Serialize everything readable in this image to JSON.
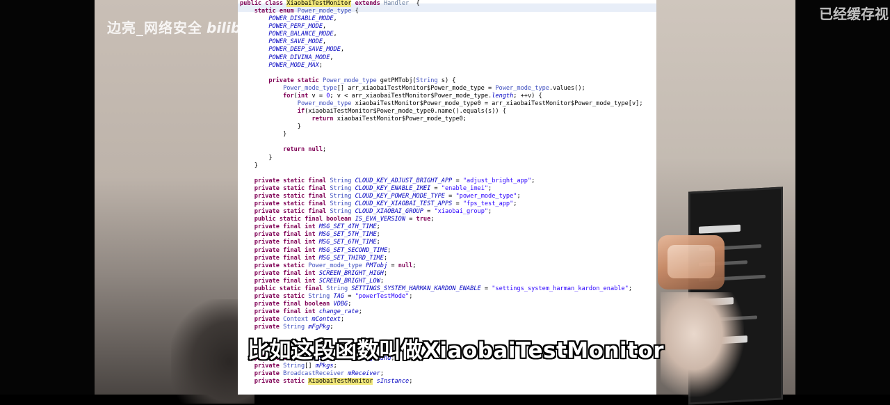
{
  "watermark": {
    "name": "边亮_网络安全",
    "platform": "bilibili"
  },
  "cache_note": "已经缓存视",
  "subtitle": "比如这段函数叫做XiaobaiTestMonitor",
  "code_lines": [
    [
      [
        "kw",
        "public class "
      ],
      [
        "hl",
        "XiaobaiTestMonitor"
      ],
      [
        "kw",
        " extends "
      ],
      [
        "grey",
        "Handler"
      ],
      [
        "",
        "  {"
      ]
    ],
    [
      [
        "",
        "    "
      ],
      [
        "kw",
        "static enum "
      ],
      [
        "ty",
        "Power_mode_type"
      ],
      [
        "",
        " {"
      ]
    ],
    [
      [
        "",
        "        "
      ],
      [
        "fi",
        "POWER_DISABLE_MODE"
      ],
      [
        "",
        ","
      ]
    ],
    [
      [
        "",
        "        "
      ],
      [
        "fi",
        "POWER_PERF_MODE"
      ],
      [
        "",
        ","
      ]
    ],
    [
      [
        "",
        "        "
      ],
      [
        "fi",
        "POWER_BALANCE_MODE"
      ],
      [
        "",
        ","
      ]
    ],
    [
      [
        "",
        "        "
      ],
      [
        "fi",
        "POWER_SAVE_MODE"
      ],
      [
        "",
        ","
      ]
    ],
    [
      [
        "",
        "        "
      ],
      [
        "fi",
        "POWER_DEEP_SAVE_MODE"
      ],
      [
        "",
        ","
      ]
    ],
    [
      [
        "",
        "        "
      ],
      [
        "fi",
        "POWER_DIVINA_MODE"
      ],
      [
        "",
        ","
      ]
    ],
    [
      [
        "",
        "        "
      ],
      [
        "fi",
        "POWER_MODE_MAX"
      ],
      [
        "",
        ";"
      ]
    ],
    [
      [
        "",
        ""
      ]
    ],
    [
      [
        "",
        "        "
      ],
      [
        "kw",
        "private static "
      ],
      [
        "ty",
        "Power_mode_type"
      ],
      [
        "",
        " getPMTobj("
      ],
      [
        "ty",
        "String"
      ],
      [
        "",
        " s) {"
      ]
    ],
    [
      [
        "",
        "            "
      ],
      [
        "ty",
        "Power_mode_type"
      ],
      [
        "",
        "[] arr_xiaobaiTestMonitor$Power_mode_type = "
      ],
      [
        "ty",
        "Power_mode_type"
      ],
      [
        "",
        ".values();"
      ]
    ],
    [
      [
        "",
        "            "
      ],
      [
        "kw",
        "for"
      ],
      [
        "",
        "("
      ],
      [
        "kw",
        "int"
      ],
      [
        "",
        " v = "
      ],
      [
        "st",
        "0"
      ],
      [
        "",
        "; v < arr_xiaobaiTestMonitor$Power_mode_type."
      ],
      [
        "fi",
        "length"
      ],
      [
        "",
        "; ++v) {"
      ]
    ],
    [
      [
        "",
        "                "
      ],
      [
        "ty",
        "Power_mode_type"
      ],
      [
        "",
        " xiaobaiTestMonitor$Power_mode_type0 = arr_xiaobaiTestMonitor$Power_mode_type[v];"
      ]
    ],
    [
      [
        "",
        "                "
      ],
      [
        "kw",
        "if"
      ],
      [
        "",
        "(xiaobaiTestMonitor$Power_mode_type0.name().equals(s)) {"
      ]
    ],
    [
      [
        "",
        "                    "
      ],
      [
        "kw",
        "return"
      ],
      [
        "",
        " xiaobaiTestMonitor$Power_mode_type0;"
      ]
    ],
    [
      [
        "",
        "                }"
      ]
    ],
    [
      [
        "",
        "            }"
      ]
    ],
    [
      [
        "",
        ""
      ]
    ],
    [
      [
        "",
        "            "
      ],
      [
        "kw",
        "return null"
      ],
      [
        "",
        ";"
      ]
    ],
    [
      [
        "",
        "        }"
      ]
    ],
    [
      [
        "",
        "    }"
      ]
    ],
    [
      [
        "",
        ""
      ]
    ],
    [
      [
        "",
        "    "
      ],
      [
        "kw",
        "private static final "
      ],
      [
        "ty",
        "String"
      ],
      [
        "",
        " "
      ],
      [
        "fi",
        "CLOUD_KEY_ADJUST_BRIGHT_APP"
      ],
      [
        "",
        " = "
      ],
      [
        "st",
        "\"adjust_bright_app\""
      ],
      [
        "",
        ";"
      ]
    ],
    [
      [
        "",
        "    "
      ],
      [
        "kw",
        "private static final "
      ],
      [
        "ty",
        "String"
      ],
      [
        "",
        " "
      ],
      [
        "fi",
        "CLOUD_KEY_ENABLE_IMEI"
      ],
      [
        "",
        " = "
      ],
      [
        "st",
        "\"enable_imei\""
      ],
      [
        "",
        ";"
      ]
    ],
    [
      [
        "",
        "    "
      ],
      [
        "kw",
        "private static final "
      ],
      [
        "ty",
        "String"
      ],
      [
        "",
        " "
      ],
      [
        "fi",
        "CLOUD_KEY_POWER_MODE_TYPE"
      ],
      [
        "",
        " = "
      ],
      [
        "st",
        "\"power_mode_type\""
      ],
      [
        "",
        ";"
      ]
    ],
    [
      [
        "",
        "    "
      ],
      [
        "kw",
        "private static final "
      ],
      [
        "ty",
        "String"
      ],
      [
        "",
        " "
      ],
      [
        "fi",
        "CLOUD_KEY_XIAOBAI_TEST_APPS"
      ],
      [
        "",
        " = "
      ],
      [
        "st",
        "\"fps_test_app\""
      ],
      [
        "",
        ";"
      ]
    ],
    [
      [
        "",
        "    "
      ],
      [
        "kw",
        "private static final "
      ],
      [
        "ty",
        "String"
      ],
      [
        "",
        " "
      ],
      [
        "fi",
        "CLOUD_XIAOBAI_GROUP"
      ],
      [
        "",
        " = "
      ],
      [
        "st",
        "\"xiaobai_group\""
      ],
      [
        "",
        ";"
      ]
    ],
    [
      [
        "",
        "    "
      ],
      [
        "kw",
        "public static final boolean "
      ],
      [
        "fi",
        "IS_EVA_VERSION"
      ],
      [
        "",
        " = "
      ],
      [
        "kw",
        "true"
      ],
      [
        "",
        ";"
      ]
    ],
    [
      [
        "",
        "    "
      ],
      [
        "kw",
        "private final int "
      ],
      [
        "fi",
        "MSG_SET_4TH_TIME"
      ],
      [
        "",
        ";"
      ]
    ],
    [
      [
        "",
        "    "
      ],
      [
        "kw",
        "private final int "
      ],
      [
        "fi",
        "MSG_SET_5TH_TIME"
      ],
      [
        "",
        ";"
      ]
    ],
    [
      [
        "",
        "    "
      ],
      [
        "kw",
        "private final int "
      ],
      [
        "fi",
        "MSG_SET_6TH_TIME"
      ],
      [
        "",
        ";"
      ]
    ],
    [
      [
        "",
        "    "
      ],
      [
        "kw",
        "private final int "
      ],
      [
        "fi",
        "MSG_SET_SECOND_TIME"
      ],
      [
        "",
        ";"
      ]
    ],
    [
      [
        "",
        "    "
      ],
      [
        "kw",
        "private final int "
      ],
      [
        "fi",
        "MSG_SET_THIRD_TIME"
      ],
      [
        "",
        ";"
      ]
    ],
    [
      [
        "",
        "    "
      ],
      [
        "kw",
        "private static "
      ],
      [
        "ty",
        "Power_mode_type"
      ],
      [
        "",
        " "
      ],
      [
        "fi",
        "PMTobj"
      ],
      [
        "",
        " = "
      ],
      [
        "kw",
        "null"
      ],
      [
        "",
        ";"
      ]
    ],
    [
      [
        "",
        "    "
      ],
      [
        "kw",
        "private final int "
      ],
      [
        "fi",
        "SCREEN_BRIGHT_HIGH"
      ],
      [
        "",
        ";"
      ]
    ],
    [
      [
        "",
        "    "
      ],
      [
        "kw",
        "private final int "
      ],
      [
        "fi",
        "SCREEN_BRIGHT_LOW"
      ],
      [
        "",
        ";"
      ]
    ],
    [
      [
        "",
        "    "
      ],
      [
        "kw",
        "public static final "
      ],
      [
        "ty",
        "String"
      ],
      [
        "",
        " "
      ],
      [
        "fi",
        "SETTINGS_SYSTEM_HARMAN_KARDON_ENABLE"
      ],
      [
        "",
        " = "
      ],
      [
        "st",
        "\"settings_system_harman_kardon_enable\""
      ],
      [
        "",
        ";"
      ]
    ],
    [
      [
        "",
        "    "
      ],
      [
        "kw",
        "private static "
      ],
      [
        "ty",
        "String"
      ],
      [
        "",
        " "
      ],
      [
        "fi",
        "TAG"
      ],
      [
        "",
        " = "
      ],
      [
        "st",
        "\"powerTestMode\""
      ],
      [
        "",
        ";"
      ]
    ],
    [
      [
        "",
        "    "
      ],
      [
        "kw",
        "private final boolean "
      ],
      [
        "fi",
        "VDBG"
      ],
      [
        "",
        ";"
      ]
    ],
    [
      [
        "",
        "    "
      ],
      [
        "kw",
        "private final int "
      ],
      [
        "fi",
        "change_rate"
      ],
      [
        "",
        ";"
      ]
    ],
    [
      [
        "",
        "    "
      ],
      [
        "kw",
        "private "
      ],
      [
        "ty",
        "Context"
      ],
      [
        "",
        " "
      ],
      [
        "fi",
        "mContext"
      ],
      [
        "",
        ";"
      ]
    ],
    [
      [
        "",
        "    "
      ],
      [
        "kw",
        "private "
      ],
      [
        "ty",
        "String"
      ],
      [
        "",
        " "
      ],
      [
        "fi",
        "mFgPkg"
      ],
      [
        "",
        ";"
      ]
    ],
    [
      [
        "",
        ""
      ]
    ],
    [
      [
        "",
        ""
      ]
    ],
    [
      [
        "",
        ""
      ]
    ],
    [
      [
        "",
        "    "
      ],
      [
        "kw",
        "private boolean "
      ],
      [
        "fi",
        "mIsXiaobaiAppForground"
      ],
      [
        "",
        ";"
      ]
    ],
    [
      [
        "",
        "    "
      ],
      [
        "kw",
        "private "
      ],
      [
        "ty",
        "String"
      ],
      [
        "",
        "[] "
      ],
      [
        "fi",
        "mPkgs"
      ],
      [
        "",
        ";"
      ]
    ],
    [
      [
        "",
        "    "
      ],
      [
        "kw",
        "private "
      ],
      [
        "ty",
        "BroadcastReceiver"
      ],
      [
        "",
        " "
      ],
      [
        "fi",
        "mReceiver"
      ],
      [
        "",
        ";"
      ]
    ],
    [
      [
        "",
        "    "
      ],
      [
        "kw",
        "private static "
      ],
      [
        "hl",
        "XiaobaiTestMonitor"
      ],
      [
        "",
        " "
      ],
      [
        "fi",
        "sInstance"
      ],
      [
        "",
        ";"
      ]
    ]
  ]
}
